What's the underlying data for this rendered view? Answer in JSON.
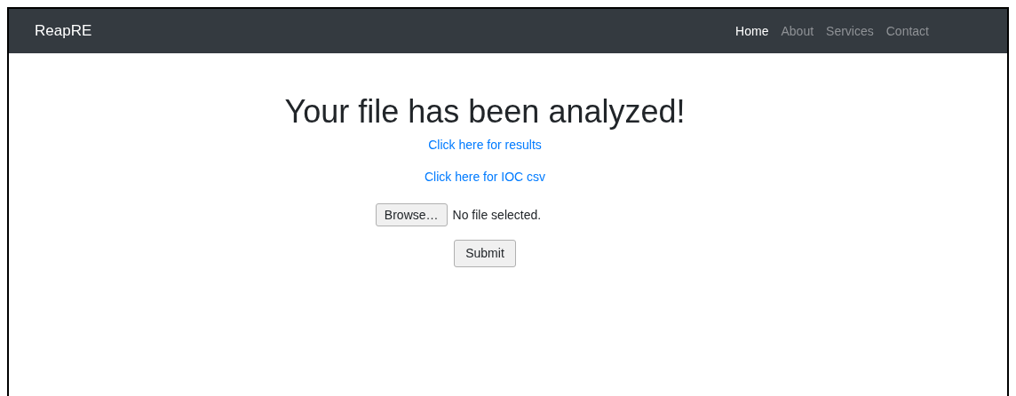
{
  "navbar": {
    "brand": "ReapRE",
    "items": [
      {
        "label": "Home",
        "selected": true
      },
      {
        "label": "About",
        "selected": false
      },
      {
        "label": "Services",
        "selected": false
      },
      {
        "label": "Contact",
        "selected": false
      }
    ]
  },
  "main": {
    "heading": "Your file has been analyzed!",
    "links": [
      "Click here for results",
      "Click here for IOC csv"
    ],
    "file_input": {
      "button": "Browse…",
      "status": "No file selected."
    },
    "submit": "Submit"
  }
}
